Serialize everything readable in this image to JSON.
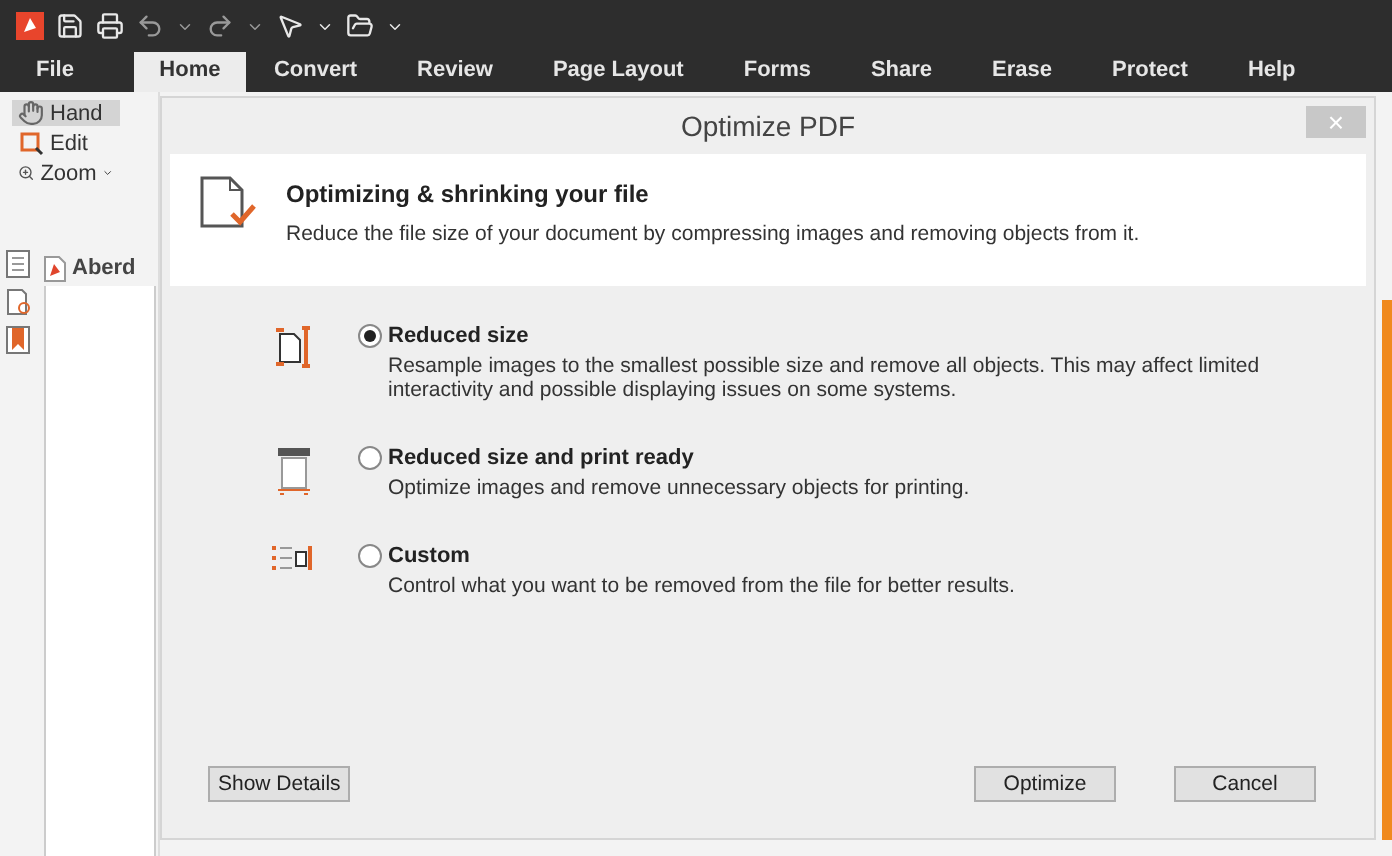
{
  "ribbon_tabs": [
    {
      "label": "File",
      "selected": false
    },
    {
      "label": "Home",
      "selected": true
    },
    {
      "label": "Convert",
      "selected": false
    },
    {
      "label": "Review",
      "selected": false
    },
    {
      "label": "Page Layout",
      "selected": false
    },
    {
      "label": "Forms",
      "selected": false
    },
    {
      "label": "Share",
      "selected": false
    },
    {
      "label": "Erase",
      "selected": false
    },
    {
      "label": "Protect",
      "selected": false
    },
    {
      "label": "Help",
      "selected": false
    }
  ],
  "tools": [
    {
      "label": "Hand",
      "kind": "hand",
      "selected": true
    },
    {
      "label": "Edit",
      "kind": "edit",
      "selected": false
    },
    {
      "label": "Zoom",
      "kind": "zoom",
      "selected": false
    }
  ],
  "document_tab": {
    "label": "Aberd"
  },
  "dialog": {
    "title": "Optimize PDF",
    "close": "×",
    "header": {
      "title": "Optimizing & shrinking your file",
      "text": "Reduce the file size of your document by compressing images and removing objects from it."
    },
    "options": [
      {
        "kind": "reduce",
        "label": "Reduced size",
        "description": "Resample images to the smallest possible size and remove all objects. This may affect limited interactivity and possible displaying issues on some systems.",
        "selected": true
      },
      {
        "kind": "print",
        "label": "Reduced size and print ready",
        "description": "Optimize images and remove unnecessary objects for printing.",
        "selected": false
      },
      {
        "kind": "custom",
        "label": "Custom",
        "description": "Control what you want to be removed from the file for better results.",
        "selected": false
      }
    ],
    "buttons": {
      "details": "Show Details",
      "optimize": "Optimize",
      "cancel": "Cancel"
    }
  }
}
